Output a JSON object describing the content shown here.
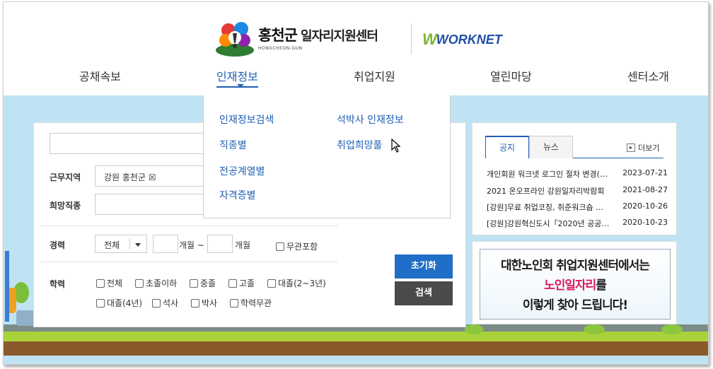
{
  "header": {
    "county_name": "홍천군",
    "center_name": "일자리지원센터",
    "county_eng": "HONGCHEON-GUN",
    "partner_logo": "WORKNET"
  },
  "nav": {
    "items": [
      {
        "label": "공채속보"
      },
      {
        "label": "인재정보"
      },
      {
        "label": "취업지원"
      },
      {
        "label": "열린마당"
      },
      {
        "label": "센터소개"
      }
    ],
    "active_index": 1
  },
  "dropdown": {
    "col1": [
      "인재정보검색",
      "직종별",
      "전공계열별",
      "자격증별"
    ],
    "col2": [
      "석박사 인재정보",
      "취업희망풀"
    ]
  },
  "search": {
    "region_label": "근무지역",
    "region_value": "강원 홍천군 ☒",
    "job_label": "희망직종",
    "career_label": "경력",
    "career_select": "전체",
    "months_unit_from": "개월 ~",
    "months_unit_to": "개월",
    "career_any": "무관포함",
    "edu_label": "학력",
    "edu_options_row1": [
      "전체",
      "초졸이하",
      "중졸",
      "고졸",
      "대졸(2~3년)"
    ],
    "edu_options_row2": [
      "대졸(4년)",
      "석사",
      "박사",
      "학력무관"
    ],
    "reset_button": "초기화",
    "search_button": "검색"
  },
  "notice": {
    "tabs": [
      "공지",
      "뉴스"
    ],
    "more_label": "더보기",
    "items": [
      {
        "title": "개인회원 워크넷 로그인 절차 변경(…",
        "date": "2023-07-21"
      },
      {
        "title": "2021 온오프라인 강원일자리박람회",
        "date": "2021-08-27"
      },
      {
        "title": "[강원]무료 취업코칭, 취준워크숍 …",
        "date": "2020-10-26"
      },
      {
        "title": "[강원]강원혁신도시「2020년 공공…",
        "date": "2020-10-23"
      }
    ]
  },
  "banner": {
    "line1": "대한노인회 취업지원센터에서는",
    "line2_highlight": "노인일자리",
    "line2_rest": "를",
    "line3": "이렇게 찾아 드립니다!"
  },
  "colors": {
    "accent_blue": "#1f5fb5",
    "reset_button": "#1f6ec8",
    "search_button": "#4a4a4a",
    "sky": "#bfe3f3",
    "grass": "#a9d23a",
    "highlight_pink": "#d81b60"
  }
}
